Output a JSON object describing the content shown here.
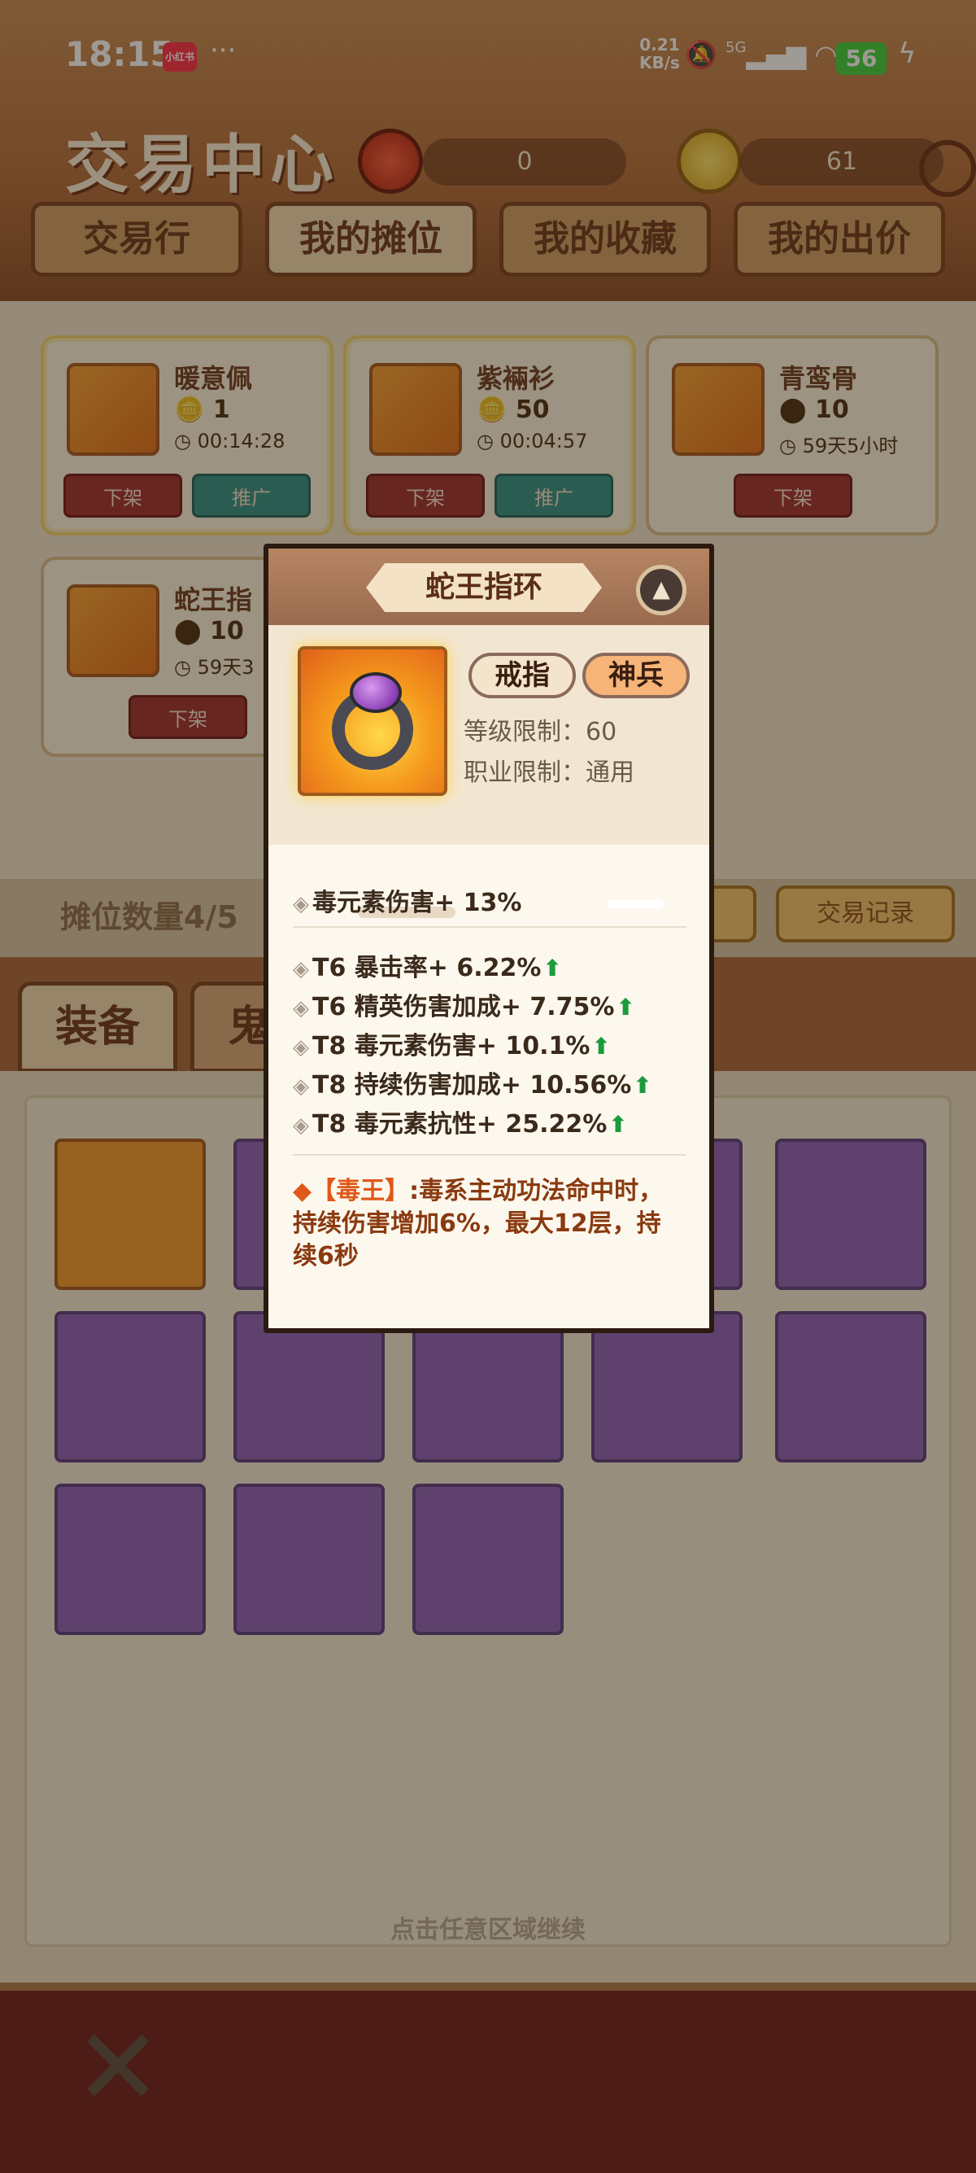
{
  "status_bar": {
    "time": "18:15",
    "app_badge": "小红书",
    "more": "···",
    "speed_value": "0.21",
    "speed_unit": "KB/s",
    "network": "5G",
    "battery": "56"
  },
  "header": {
    "title": "交易中心",
    "currency_1_value": "0",
    "currency_2_value": "61",
    "tabs": [
      {
        "label": "交易行",
        "active": false
      },
      {
        "label": "我的摊位",
        "active": true
      },
      {
        "label": "我的收藏",
        "active": false
      },
      {
        "label": "我的出价",
        "active": false
      }
    ]
  },
  "stall": {
    "items": [
      {
        "name": "暖意佩",
        "price": "1",
        "time": "00:14:28",
        "btn_down": "下架",
        "btn_promo": "推广"
      },
      {
        "name": "紫裲衫",
        "price": "50",
        "time": "00:04:57",
        "btn_down": "下架",
        "btn_promo": "推广"
      },
      {
        "name": "青鸾骨",
        "price": "10",
        "time": "59天5小时",
        "btn_down": "下架"
      },
      {
        "name": "蛇王指",
        "price": "10",
        "time": "59天3",
        "btn_down": "下架"
      }
    ],
    "count_label": "摊位数量4/5",
    "record_button": "交易记录"
  },
  "inventory": {
    "tabs": [
      "装备",
      "鬼画"
    ]
  },
  "popup": {
    "title": "蛇王指环",
    "tag_type": "戒指",
    "tag_rank": "神兵",
    "level_limit": "等级限制：60",
    "class_limit": "职业限制：通用",
    "base_attr": "毒元素伤害+ 13%",
    "extra_attrs": [
      "T6 暴击率+ 6.22%",
      "T6 精英伤害加成+ 7.75%",
      "T8 毒元素伤害+ 10.1%",
      "T8 持续伤害加成+ 10.56%",
      "T8 毒元素抗性+ 25.22%"
    ],
    "skill_name": "【毒王】",
    "skill_desc": ":毒系主动功法命中时，持续伤害增加6%，最大12层，持续6秒"
  },
  "hint": "点击任意区域继续",
  "icons": {
    "collapse": "chevron-up-icon",
    "close": "close-icon",
    "attr_bullet": "diamond-icon",
    "upgrade": "arrow-up-icon"
  },
  "colors": {
    "accent_brown": "#7b3f1c",
    "upgrade_green": "#1d9a3c",
    "skill_orange": "#8a3a10"
  }
}
